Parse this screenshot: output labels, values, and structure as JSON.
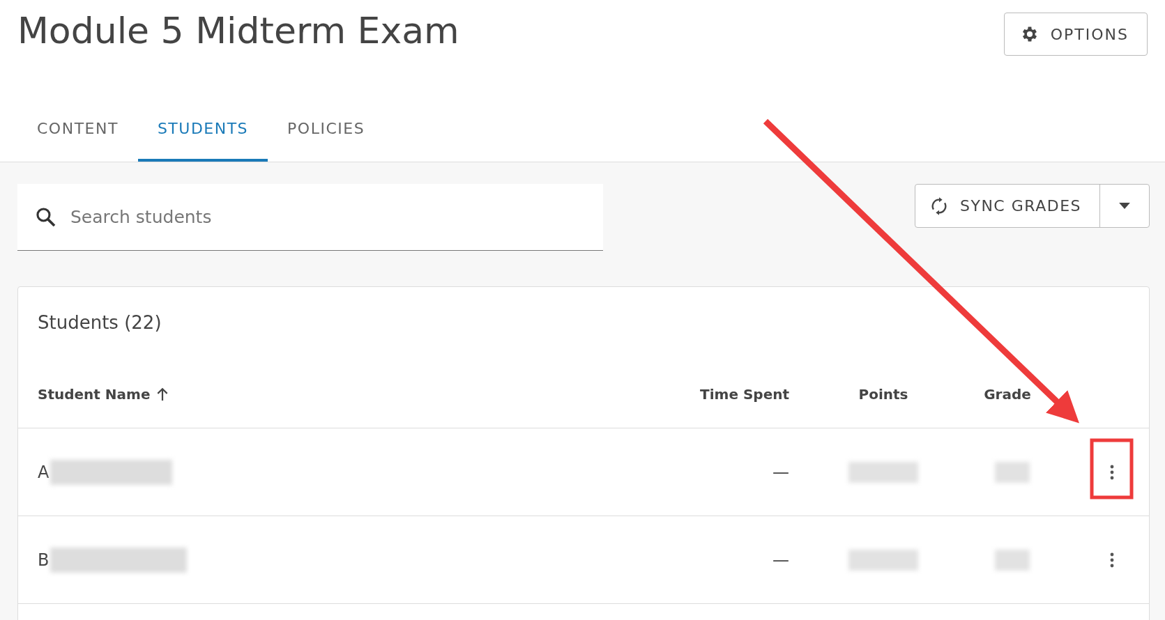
{
  "title": "Module 5 Midterm Exam",
  "options_button": {
    "label": "OPTIONS"
  },
  "tabs": [
    {
      "label": "CONTENT",
      "selected": false
    },
    {
      "label": "STUDENTS",
      "selected": true
    },
    {
      "label": "POLICIES",
      "selected": false
    }
  ],
  "search": {
    "placeholder": "Search students"
  },
  "sync_button": {
    "label": "SYNC GRADES"
  },
  "students_card": {
    "title": "Students (22)",
    "columns": [
      "Student Name",
      "Time Spent",
      "Points",
      "Grade"
    ],
    "rows": [
      {
        "name": "A",
        "time_spent": "—"
      },
      {
        "name": "B",
        "time_spent": "—"
      }
    ]
  }
}
